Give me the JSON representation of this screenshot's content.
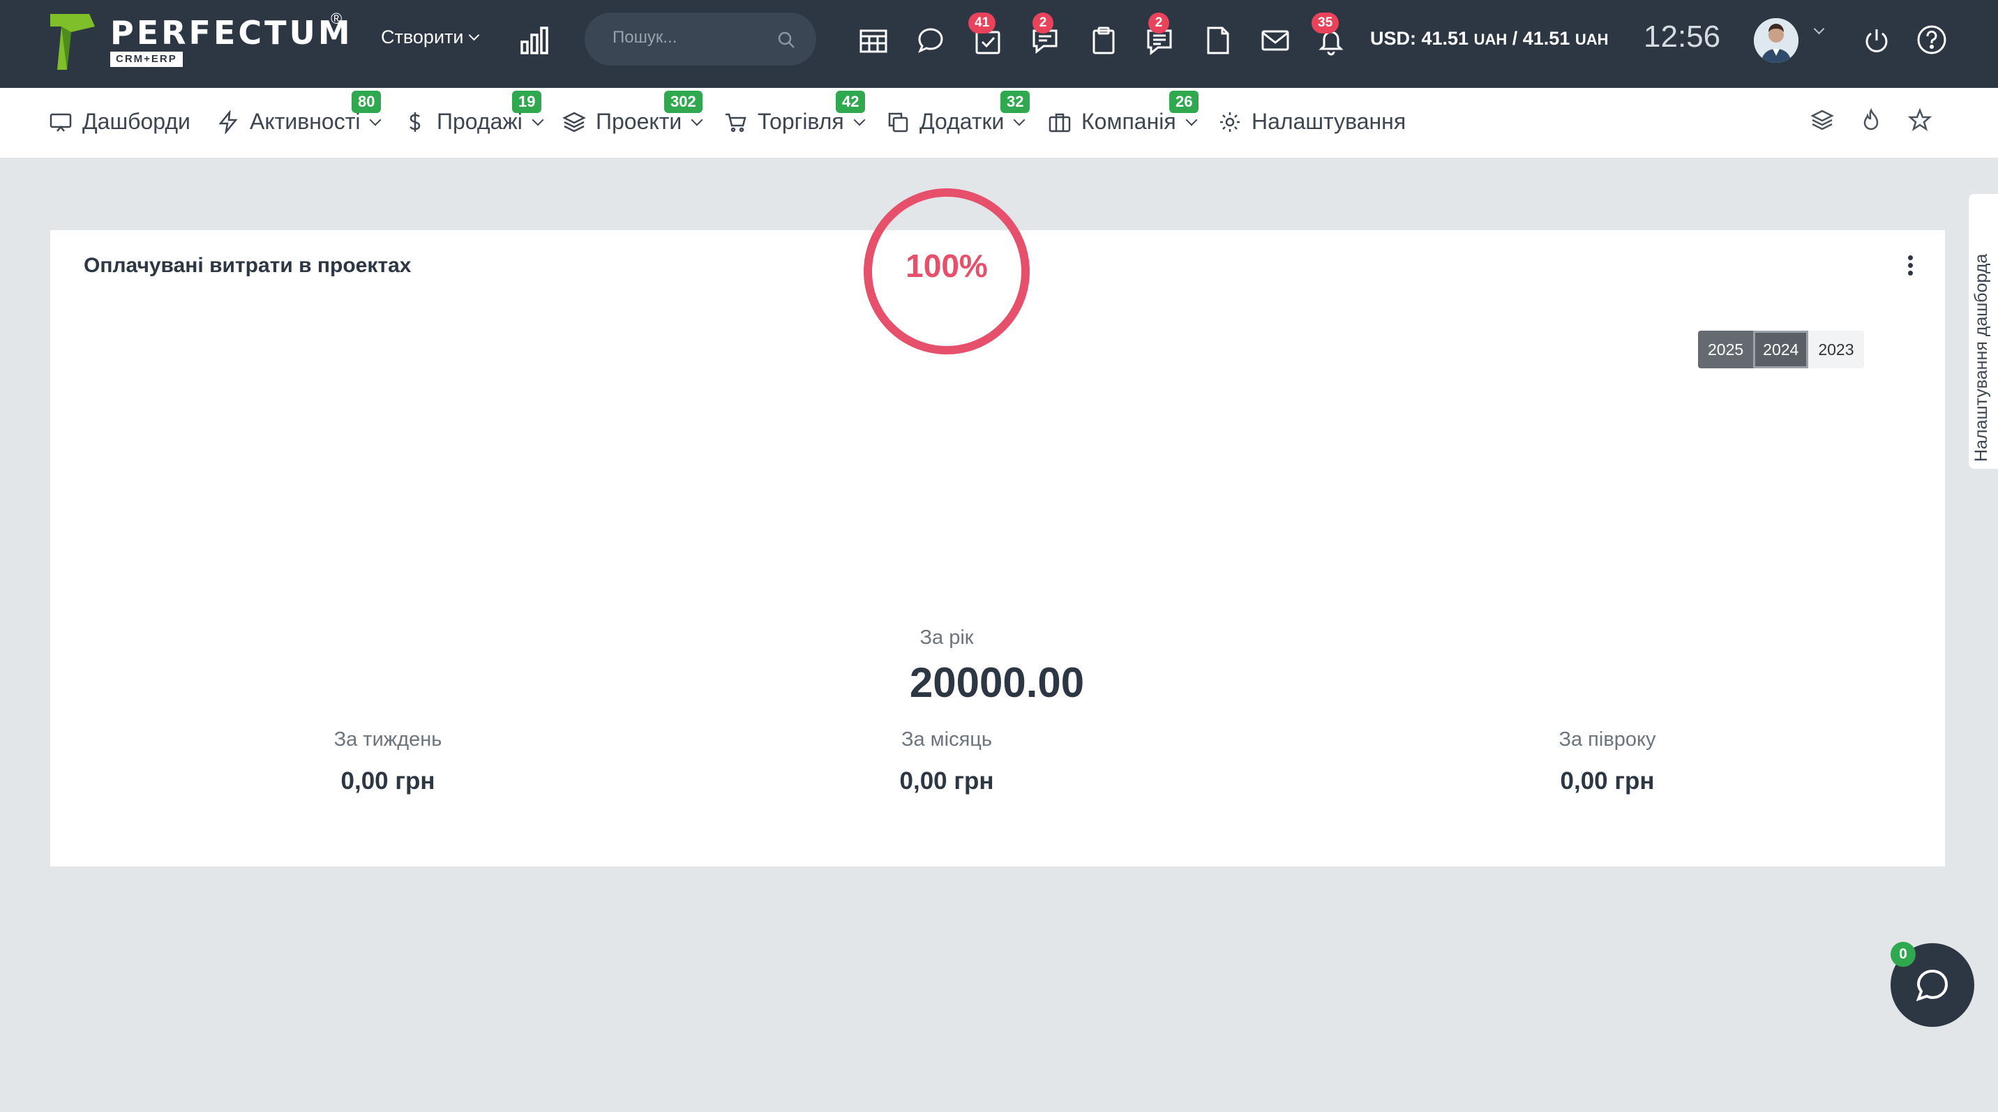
{
  "header": {
    "logo_word": "PERFECTUM",
    "logo_reg": "®",
    "logo_sub": "CRM+ERP",
    "create_label": "Створити",
    "search_placeholder": "Пошук...",
    "badges": {
      "tasks": "41",
      "chat": "2",
      "notes": "2",
      "bell": "35"
    },
    "currency_usd": "USD: 41.51",
    "currency_uah1": "UAH",
    "currency_sep": " / 41.51 ",
    "currency_uah2": "UAH",
    "clock": "12:56"
  },
  "nav": {
    "items": [
      {
        "label": "Дашборди",
        "icon": "monitor-icon"
      },
      {
        "label": "Активності",
        "icon": "bolt-icon",
        "badge": "80"
      },
      {
        "label": "Продажі",
        "icon": "dollar-icon",
        "badge": "19"
      },
      {
        "label": "Проекти",
        "icon": "layers-icon",
        "badge": "302"
      },
      {
        "label": "Торгівля",
        "icon": "cart-icon",
        "badge": "42"
      },
      {
        "label": "Додатки",
        "icon": "copy-icon",
        "badge": "32"
      },
      {
        "label": "Компанія",
        "icon": "briefcase-icon",
        "badge": "26"
      },
      {
        "label": "Налаштування",
        "icon": "gear-icon"
      }
    ]
  },
  "widget": {
    "title": "Оплачувані витрати в проектах",
    "years": [
      "2025",
      "2024",
      "2023"
    ],
    "active_year": "2024",
    "percent": "100%",
    "percent_value": 100,
    "year_label": "За рік",
    "year_value": "20000.00",
    "week_label": "За тиждень",
    "week_value": "0,00 грн",
    "month_label": "За місяць",
    "month_value": "0,00 грн",
    "halfyear_label": "За півроку",
    "halfyear_value": "0,00 грн"
  },
  "side_tab": "Налаштування дашборда",
  "chat": {
    "badge": "0"
  },
  "colors": {
    "topbar": "#2d3743",
    "accent_red": "#e6506a",
    "badge_red": "#e8435a",
    "badge_green": "#2fa84f"
  }
}
